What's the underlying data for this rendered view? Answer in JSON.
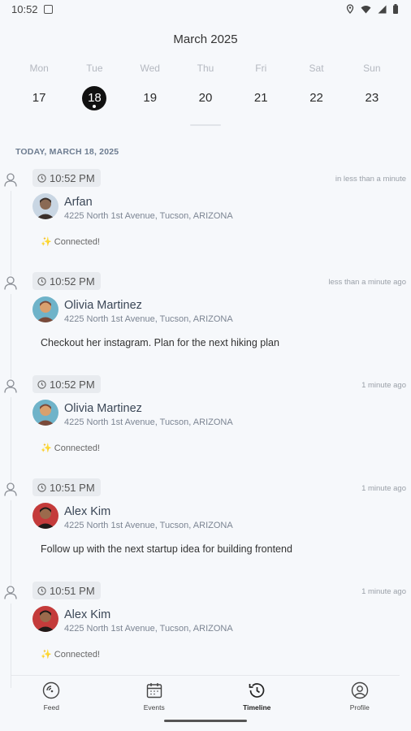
{
  "status_bar": {
    "time": "10:52"
  },
  "calendar": {
    "month_title": "March 2025",
    "days": [
      {
        "name": "Mon",
        "num": "17",
        "selected": false
      },
      {
        "name": "Tue",
        "num": "18",
        "selected": true
      },
      {
        "name": "Wed",
        "num": "19",
        "selected": false
      },
      {
        "name": "Thu",
        "num": "20",
        "selected": false
      },
      {
        "name": "Fri",
        "num": "21",
        "selected": false
      },
      {
        "name": "Sat",
        "num": "22",
        "selected": false
      },
      {
        "name": "Sun",
        "num": "23",
        "selected": false
      }
    ]
  },
  "timeline": {
    "section_label": "TODAY, MARCH 18, 2025",
    "entries": [
      {
        "time": "10:52 PM",
        "relative": "in less than a minute",
        "name": "Arfan",
        "address": "4225 North 1st Avenue, Tucson, ARIZONA",
        "note": "✨ Connected!",
        "note_type": "status",
        "avatar_colors": [
          "#8a6a55",
          "#3a2f2a",
          "#c9d6e3"
        ]
      },
      {
        "time": "10:52 PM",
        "relative": "less than a minute ago",
        "name": "Olivia Martinez",
        "address": "4225 North 1st Avenue, Tucson, ARIZONA",
        "note": "Checkout her instagram. Plan for the next hiking plan",
        "note_type": "message",
        "avatar_colors": [
          "#d9a06e",
          "#7a4a3a",
          "#6fb3c9"
        ]
      },
      {
        "time": "10:52 PM",
        "relative": "1 minute ago",
        "name": "Olivia Martinez",
        "address": "4225 North 1st Avenue, Tucson, ARIZONA",
        "note": "✨ Connected!",
        "note_type": "status",
        "avatar_colors": [
          "#d9a06e",
          "#7a4a3a",
          "#6fb3c9"
        ]
      },
      {
        "time": "10:51 PM",
        "relative": "1 minute ago",
        "name": "Alex Kim",
        "address": "4225 North 1st Avenue, Tucson, ARIZONA",
        "note": "Follow up with the next startup idea for building frontend",
        "note_type": "message",
        "avatar_colors": [
          "#9b6a4c",
          "#1f1a18",
          "#c43b3b"
        ]
      },
      {
        "time": "10:51 PM",
        "relative": "1 minute ago",
        "name": "Alex Kim",
        "address": "4225 North 1st Avenue, Tucson, ARIZONA",
        "note": "✨ Connected!",
        "note_type": "status",
        "avatar_colors": [
          "#9b6a4c",
          "#1f1a18",
          "#c43b3b"
        ]
      }
    ]
  },
  "bottom_nav": {
    "items": [
      {
        "label": "Feed",
        "icon": "feed-icon",
        "active": false
      },
      {
        "label": "Events",
        "icon": "calendar-icon",
        "active": false
      },
      {
        "label": "Timeline",
        "icon": "history-icon",
        "active": true
      },
      {
        "label": "Profile",
        "icon": "profile-icon",
        "active": false
      }
    ]
  }
}
